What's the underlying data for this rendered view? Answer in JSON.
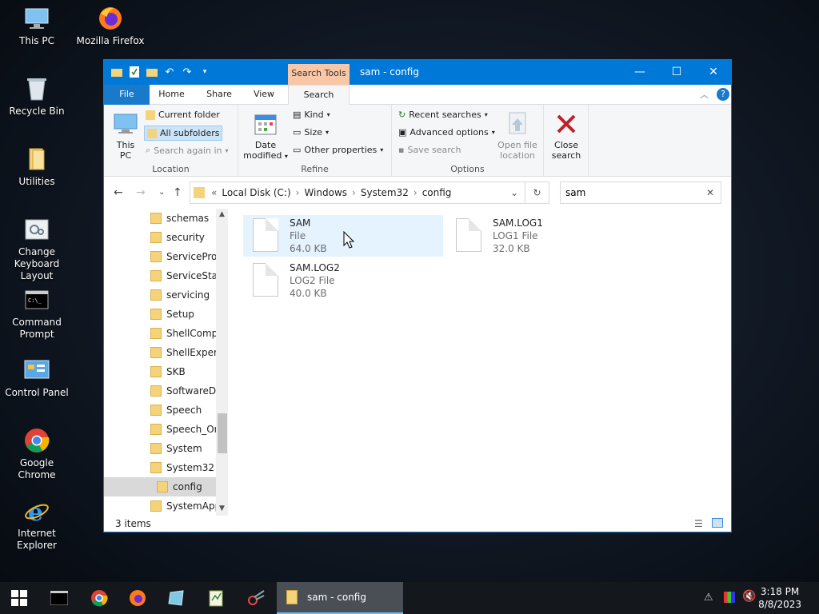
{
  "desktop": {
    "icons": [
      {
        "label": "This PC",
        "icon": "this-pc-icon"
      },
      {
        "label": "Mozilla Firefox",
        "icon": "firefox-icon"
      },
      {
        "label": "Recycle Bin",
        "icon": "recycle-bin-icon"
      },
      {
        "label": "Utilities",
        "icon": "folder-icon"
      },
      {
        "label": "Change Keyboard Layout",
        "icon": "keyboard-layout-icon"
      },
      {
        "label": "Command Prompt",
        "icon": "cmd-icon"
      },
      {
        "label": "Control Panel",
        "icon": "control-panel-icon"
      },
      {
        "label": "Google Chrome",
        "icon": "chrome-icon"
      },
      {
        "label": "Internet Explorer",
        "icon": "ie-icon"
      }
    ]
  },
  "window": {
    "title": "sam - config",
    "context_tab": "Search Tools",
    "tabs": [
      "File",
      "Home",
      "Share",
      "View",
      "Search"
    ],
    "ribbon": {
      "location": {
        "this_pc": "This PC",
        "current_folder": "Current folder",
        "all_subfolders": "All subfolders",
        "search_again_in": "Search again in",
        "label": "Location"
      },
      "refine": {
        "date_modified": "Date modified",
        "kind": "Kind",
        "size": "Size",
        "other_properties": "Other properties",
        "label": "Refine"
      },
      "options": {
        "recent_searches": "Recent searches",
        "advanced_options": "Advanced options",
        "save_search": "Save search",
        "open_file_location": "Open file location",
        "label": "Options"
      },
      "close_search": "Close search"
    },
    "address": {
      "prefix": "«",
      "crumbs": [
        "Local Disk (C:)",
        "Windows",
        "System32",
        "config"
      ]
    },
    "search_value": "sam",
    "tree": [
      "schemas",
      "security",
      "ServiceProfi",
      "ServiceState",
      "servicing",
      "Setup",
      "ShellCompo",
      "ShellExperie",
      "SKB",
      "SoftwareDis",
      "Speech",
      "Speech_One",
      "System",
      "System32",
      "config",
      "SystemApps"
    ],
    "tree_selected": "config",
    "files": [
      {
        "name": "SAM",
        "type": "File",
        "size": "64.0 KB"
      },
      {
        "name": "SAM.LOG1",
        "type": "LOG1 File",
        "size": "32.0 KB"
      },
      {
        "name": "SAM.LOG2",
        "type": "LOG2 File",
        "size": "40.0 KB"
      }
    ],
    "status": "3 items"
  },
  "taskbar": {
    "active_window": "sam - config",
    "time": "3:18 PM",
    "date": "8/8/2023"
  },
  "colors": {
    "titlebar": "#0078d7",
    "context_tab": "#f9c7a6",
    "selection": "#e5f3ff",
    "taskbar": "#14171c"
  }
}
